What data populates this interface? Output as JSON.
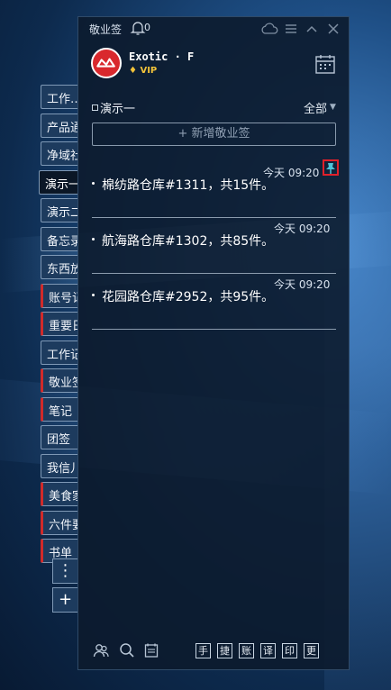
{
  "app": {
    "title": "敬业签",
    "notification_count": "0"
  },
  "profile": {
    "name": "Exotic · F",
    "badge": "VIP"
  },
  "side_tabs": [
    {
      "label": "工作…",
      "active": false,
      "red": false
    },
    {
      "label": "产品通",
      "active": false,
      "red": false
    },
    {
      "label": "净域社",
      "active": false,
      "red": false
    },
    {
      "label": "演示一",
      "active": true,
      "red": false
    },
    {
      "label": "演示二",
      "active": false,
      "red": false
    },
    {
      "label": "备忘录",
      "active": false,
      "red": false
    },
    {
      "label": "东西放",
      "active": false,
      "red": false
    },
    {
      "label": "账号记",
      "active": false,
      "red": true
    },
    {
      "label": "重要日",
      "active": false,
      "red": true
    },
    {
      "label": "工作记",
      "active": false,
      "red": false
    },
    {
      "label": "敬业签",
      "active": false,
      "red": true
    },
    {
      "label": "笔记",
      "active": false,
      "red": true
    },
    {
      "label": "团签",
      "active": false,
      "red": false
    },
    {
      "label": "我信儿",
      "active": false,
      "red": false
    },
    {
      "label": "美食家",
      "active": false,
      "red": true
    },
    {
      "label": "六件要",
      "active": false,
      "red": true
    },
    {
      "label": "书单",
      "active": false,
      "red": true
    }
  ],
  "side_more": "⋮",
  "side_add": "+",
  "group": {
    "name": "演示一",
    "filter": "全部"
  },
  "add_note_label": "+ 新增敬业签",
  "notes": [
    {
      "time": "今天 09:20",
      "text": "棉纺路仓库#1311，共15件。",
      "pinned": true
    },
    {
      "time": "今天 09:20",
      "text": "航海路仓库#1302，共85件。",
      "pinned": false
    },
    {
      "time": "今天 09:20",
      "text": "花园路仓库#2952，共95件。",
      "pinned": false
    }
  ],
  "bottom_keys": [
    "手",
    "捷",
    "账",
    "译",
    "印",
    "更"
  ],
  "colors": {
    "accent_red": "#d9282d",
    "pin": "#4fc3d9",
    "vip": "#f2c33a"
  },
  "icons": {
    "bell": "bell-icon",
    "cloud": "cloud-sync-icon",
    "menu": "menu-icon",
    "collapse": "chevron-up-icon",
    "close": "close-icon",
    "calendar": "calendar-icon",
    "pin": "pin-icon",
    "users": "users-icon",
    "search": "search-icon",
    "notes": "notes-icon"
  }
}
